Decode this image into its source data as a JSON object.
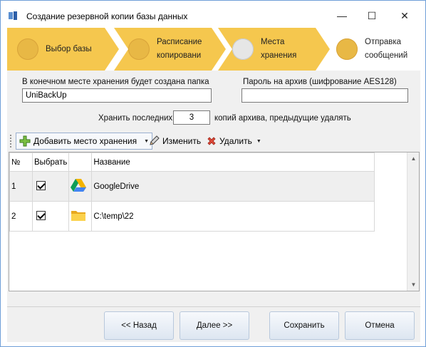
{
  "window": {
    "title": "Создание резервной копии базы данных",
    "controls": {
      "minimize": "—",
      "maximize": "☐",
      "close": "✕"
    }
  },
  "steps": [
    {
      "label": "Выбор базы",
      "state": "completed",
      "icon": "step-dot"
    },
    {
      "label": "Расписание\nкопировани",
      "state": "completed",
      "icon": "step-dot"
    },
    {
      "label": "Места\nхранения",
      "state": "current",
      "icon": "step-dot"
    },
    {
      "label": "Отправка\nсообщений",
      "state": "pending",
      "icon": "step-dot"
    }
  ],
  "folder": {
    "label": "В конечном месте хранения будет создана папка",
    "value": "UniBackUp"
  },
  "password": {
    "label": "Пароль на архив (шифрование AES128)",
    "value": ""
  },
  "keep": {
    "prefix": "Хранить последних",
    "value": "3",
    "suffix": "копий архива, предыдущие удалять"
  },
  "toolbar": {
    "add_label": "Добавить место хранения",
    "edit_label": "Изменить",
    "delete_label": "Удалить"
  },
  "table": {
    "columns": [
      "№",
      "Выбрать",
      "",
      "Название"
    ],
    "rows": [
      {
        "num": "1",
        "checked": true,
        "icon": "google-drive-icon",
        "name": "GoogleDrive"
      },
      {
        "num": "2",
        "checked": true,
        "icon": "folder-icon",
        "name": "C:\\temp\\22"
      }
    ]
  },
  "footer": {
    "back_label": "<< Назад",
    "next_label": "Далее >>",
    "save_label": "Сохранить",
    "cancel_label": "Отмена"
  },
  "colors": {
    "step_done": "#f5c74e",
    "step_current": "#f5c74e",
    "step_pending": "#ffffff",
    "dot": "#e8b845",
    "dot_current": "#e6e6e6",
    "window_border": "#6f9fd8"
  }
}
